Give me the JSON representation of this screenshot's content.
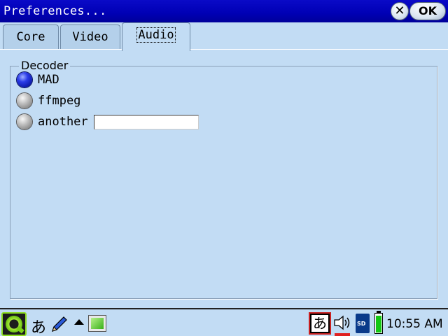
{
  "window": {
    "title": "Preferences...",
    "close_label": "✕",
    "ok_label": "OK"
  },
  "tabs": [
    {
      "label": "Core",
      "active": false
    },
    {
      "label": "Video",
      "active": false
    },
    {
      "label": "Audio",
      "active": true
    }
  ],
  "decoder": {
    "group_title": "Decoder",
    "options": [
      {
        "label": "MAD",
        "selected": true
      },
      {
        "label": "ffmpeg",
        "selected": false
      },
      {
        "label": "another",
        "selected": false
      }
    ],
    "another_value": ""
  },
  "taskbar": {
    "input_method_label": "あ",
    "input_method_box_label": "あ",
    "clock": "10:55 AM",
    "sd_label": "SD",
    "icons": [
      "qtopia-start-icon",
      "pen-icon",
      "up-arrow-icon",
      "screen-icon",
      "speaker-icon",
      "sd-card-icon",
      "battery-icon"
    ]
  },
  "colors": {
    "titlebar": "#0000b4",
    "background": "#c2dcf4",
    "radio_selected": "#2a3be8",
    "battery": "#14c814"
  }
}
